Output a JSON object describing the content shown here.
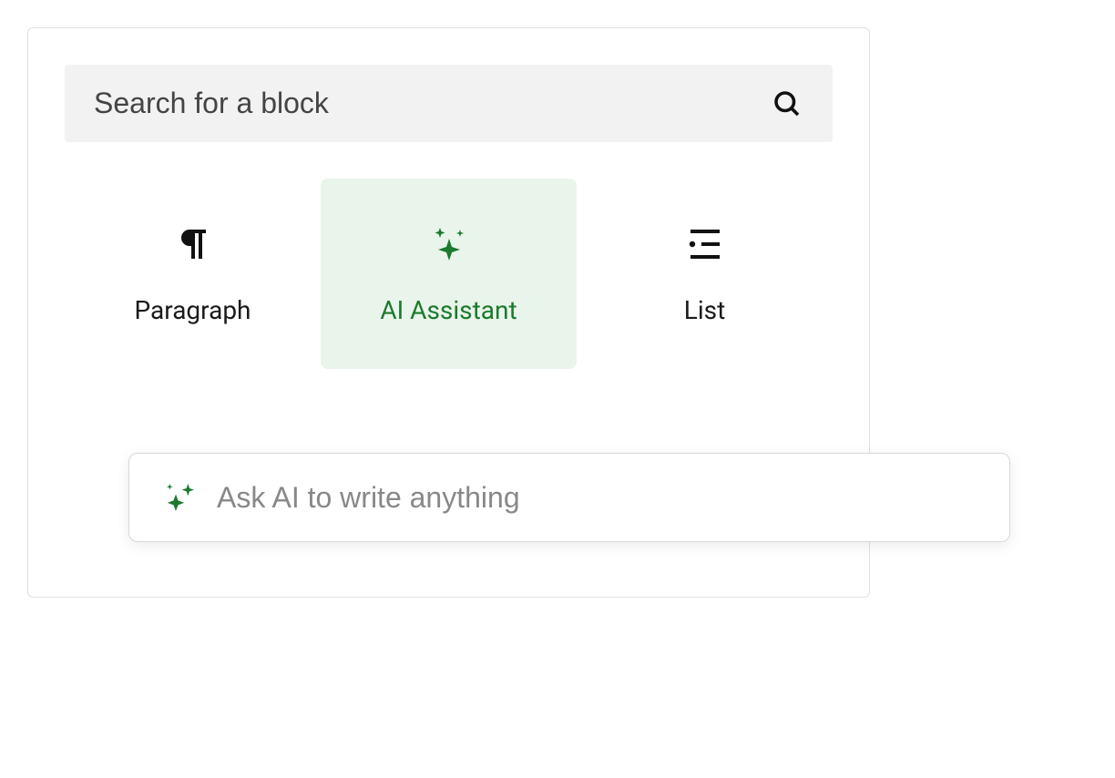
{
  "search": {
    "placeholder": "Search for a block"
  },
  "blocks": {
    "paragraph": {
      "label": "Paragraph"
    },
    "ai_assistant": {
      "label": "AI Assistant"
    },
    "list": {
      "label": "List"
    }
  },
  "ai_prompt": {
    "placeholder": "Ask AI to write anything"
  },
  "colors": {
    "accent_green": "#1b7a2d",
    "selected_bg": "#e9f4ea"
  }
}
